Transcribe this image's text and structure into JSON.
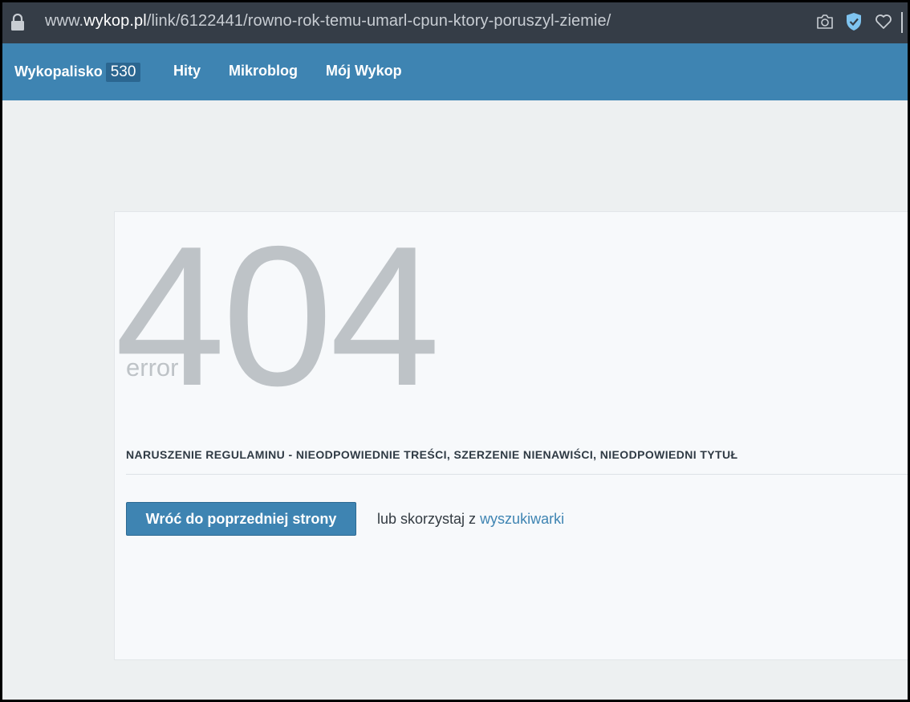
{
  "browser": {
    "url_prefix": "www.",
    "url_domain": "wykop.pl",
    "url_path": "/link/6122441/rowno-rok-temu-umarl-cpun-ktory-poruszyl-ziemie/",
    "icons": [
      "lock-icon",
      "camera-icon",
      "shield-check-icon",
      "heart-icon"
    ]
  },
  "nav": {
    "wykopalisko_label": "Wykopalisko",
    "wykopalisko_count": "530",
    "hity_label": "Hity",
    "mikroblog_label": "Mikroblog",
    "moj_wykop_label": "Mój Wykop",
    "bg_color": "#3e84b2"
  },
  "error": {
    "code": "404",
    "word": "error",
    "reason": "NARUSZENIE REGULAMINU - NIEODPOWIEDNIE TREŚCI, SZERZENIE NIENAWIŚCI, NIEODPOWIEDNI TYTUŁ",
    "back_button_label": "Wróć do poprzedniej strony",
    "alt_text": "lub skorzystaj z",
    "alt_link_label": "wyszukiwarki"
  }
}
